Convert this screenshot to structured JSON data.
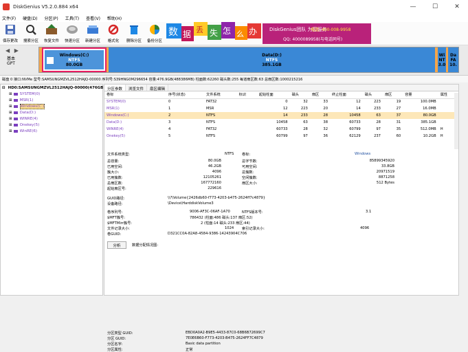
{
  "window": {
    "title": "DiskGenius V5.2.0.884 x64"
  },
  "menu": [
    "文件(F)",
    "硬盘(D)",
    "分区(P)",
    "工具(T)",
    "查看(V)",
    "帮助(H)"
  ],
  "toolbar": [
    {
      "label": "保存更改",
      "icon": "save-icon",
      "color": "#4b6cb7"
    },
    {
      "label": "搜索分区",
      "icon": "search-icon",
      "color": "#333"
    },
    {
      "label": "恢复文件",
      "icon": "recover-icon",
      "color": "#8a5a2b"
    },
    {
      "label": "快速分区",
      "icon": "quick-partition-icon",
      "color": "#7a7a7a"
    },
    {
      "label": "新建分区",
      "icon": "new-partition-icon",
      "color": "#3a7bd5"
    },
    {
      "label": "格式化",
      "icon": "format-icon",
      "color": "#d62828"
    },
    {
      "label": "删除分区",
      "icon": "delete-icon",
      "color": "#1e88e5"
    },
    {
      "label": "备份分区",
      "icon": "backup-icon",
      "color": "#2e7d32"
    }
  ],
  "banner": {
    "chars": [
      "数",
      "据",
      "丢",
      "失",
      "怎",
      "么",
      "办"
    ],
    "brand": "DiskGenius团队 为您服务",
    "phone": "电话: 400-008-9958",
    "qq": "QQ: 4000089958(与电话同号)"
  },
  "diskbar": {
    "nav": "◀ ▶",
    "basic_label": "基本",
    "gpt_label": "GPT",
    "partitions": [
      {
        "name": "Windows(C:)",
        "fs": "NTFS",
        "size": "80.0GB",
        "color": "#3a88d6",
        "selected": true
      },
      {
        "name": "Data(D:)",
        "fs": "NTFS",
        "size": "385.1GB",
        "color": "#3a88d6"
      },
      {
        "name": "Wi",
        "fs": "NT",
        "size": "3.0",
        "color": "#3a88d6"
      },
      {
        "name": "Da",
        "fs": "FA",
        "size": "10.",
        "color": "#3a88d6"
      }
    ]
  },
  "infobar": "磁盘 0 接口:NVMe  型号:SAMSUNGMZVL2512HAJQ-00000  序列号:S39HNG0M296654  容量:476.9GB(488386MB)  柱面数:62260  磁头数:255  每道扇区数:63  总扇区数:1000215216",
  "tree": {
    "disk": "HD0:SAMSUNGMZVL2512HAJQ-00000(476GB)",
    "items": [
      {
        "label": "SYSTEM(0)",
        "color": "#7b3fbf"
      },
      {
        "label": "MSR(1)",
        "color": "#7b3fbf"
      },
      {
        "label": "Windows(C:)",
        "color": "#7b3fbf",
        "selected": true
      },
      {
        "label": "Data(D:)",
        "color": "#7b3fbf"
      },
      {
        "label": "WINRE(4)",
        "color": "#7b3fbf"
      },
      {
        "label": "Onekey(5)",
        "color": "#7b3fbf"
      },
      {
        "label": "WinRE(6)",
        "color": "#7b3fbf"
      }
    ]
  },
  "tabs": [
    "分区参数",
    "浏览文件",
    "扇区编辑"
  ],
  "table": {
    "headers": [
      "卷标",
      "序号(状态)",
      "文件系统",
      "标识",
      "起始柱面",
      "磁头",
      "扇区",
      "终止柱面",
      "磁头",
      "扇区",
      "容量",
      "属性"
    ],
    "rows": [
      [
        "SYSTEM(0)",
        "0",
        "FAT32",
        "",
        "0",
        "32",
        "33",
        "12",
        "223",
        "19",
        "100.0MB",
        ""
      ],
      [
        "MSR(1)",
        "1",
        "MSR",
        "",
        "12",
        "223",
        "20",
        "14",
        "233",
        "27",
        "16.0MB",
        ""
      ],
      [
        "Windows(C:)",
        "2",
        "NTFS",
        "",
        "14",
        "233",
        "28",
        "10458",
        "63",
        "37",
        "80.0GB",
        ""
      ],
      [
        "Data(D:)",
        "3",
        "NTFS",
        "",
        "10458",
        "63",
        "38",
        "60733",
        "28",
        "31",
        "385.1GB",
        ""
      ],
      [
        "WINRE(4)",
        "4",
        "FAT32",
        "",
        "60733",
        "28",
        "32",
        "60799",
        "97",
        "35",
        "512.0MB",
        "H"
      ],
      [
        "Onekey(5)",
        "5",
        "NTFS",
        "",
        "60799",
        "97",
        "36",
        "62129",
        "237",
        "60",
        "10.2GB",
        "H"
      ]
    ],
    "selected_row": 2
  },
  "props": {
    "fs_type_label": "文件系统类型:",
    "fs_type": "NTFS",
    "vol_label": "卷标:",
    "vol": "Windows",
    "rows": [
      [
        "总容量:",
        "80.0GB",
        "总字节数:",
        "85899345920"
      ],
      [
        "已用空间:",
        "46.2GB",
        "可用空间:",
        "33.8GB"
      ],
      [
        "簇大小:",
        "4096",
        "总簇数:",
        "20971519"
      ],
      [
        "已用簇数:",
        "12105261",
        "空闲簇数:",
        "8871258"
      ],
      [
        "总扇区数:",
        "167772160",
        "扇区大小:",
        "512 Bytes"
      ],
      [
        "起始扇区号:",
        "229616",
        "",
        ""
      ]
    ],
    "guid_path_label": "GUID路径:",
    "guid_path": "\\\\?\\Volume{2426db60-f773-4203-b475-2624ff7c4879}",
    "dev_path_label": "设备路径:",
    "dev_path": "\\Device\\HarddiskVolume3",
    "serial_label": "卷序列号:",
    "serial": "9006-AF3C-06AF-1A70",
    "ntfs_ver_label": "NTFS版本号:",
    "ntfs_ver": "3.1",
    "mft_label": "$MFT簇号:",
    "mft": "786432 (柱面:486 磁头:137 扇区:52)",
    "mftmirr_label": "$MFTMirr簇号:",
    "mftmirr": "2 (柱面:14 磁头:233 扇区:44)",
    "rec_size_label": "文件记录大小:",
    "rec_size": "1024",
    "idx_size_label": "索引记录大小:",
    "idx_size": "4096",
    "vol_guid_label": "卷GUID:",
    "vol_guid": "D321CC0A-82A8-4584-9386-14243904C706",
    "analyze_btn": "分析",
    "alloc_label": "数据分配情况图:",
    "ptype_guid_label": "分区类型 GUID:",
    "ptype_guid": "EBD0A0A2-B9E5-4433-87C0-68B6B72699C7",
    "p_guid_label": "分区 GUID:",
    "p_guid": "7E0E6B60-F773-4203-B475-2624FF7C4879",
    "p_name_label": "分区名字:",
    "p_name": "Basic data partition",
    "p_attr_label": "分区属性:",
    "p_attr": "正常"
  }
}
